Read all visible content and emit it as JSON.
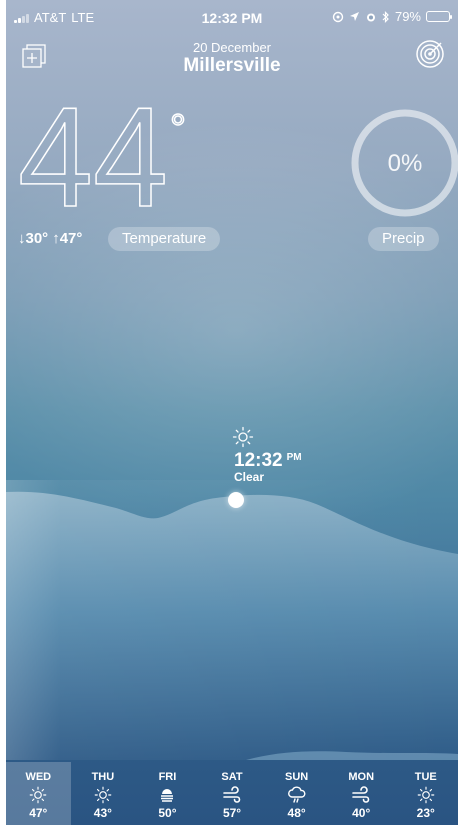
{
  "status_bar": {
    "carrier": "AT&T",
    "network": "LTE",
    "time": "12:32 PM",
    "battery": "79%",
    "battery_level": 0.79,
    "icons": [
      "screen-lock-icon",
      "location-icon",
      "alarm-icon",
      "bluetooth-icon"
    ]
  },
  "header": {
    "date": "20 December",
    "city": "Millersville",
    "left_icon": "add-location-icon",
    "right_icon": "radar-target-icon"
  },
  "current": {
    "temperature": "44",
    "degree": "°",
    "low": "↓30°",
    "high": "↑47°",
    "temperature_label": "Temperature",
    "precip_value": "0%",
    "precip_level": 0.0,
    "precip_label": "Precip"
  },
  "timeline": {
    "time": "12:32",
    "ampm": "PM",
    "condition": "Clear",
    "icon": "sun-icon"
  },
  "forecast": [
    {
      "day": "WED",
      "icon": "sun-icon",
      "temp": "47°",
      "active": true
    },
    {
      "day": "THU",
      "icon": "sun-icon",
      "temp": "43°",
      "active": false
    },
    {
      "day": "FRI",
      "icon": "fog-icon",
      "temp": "50°",
      "active": false
    },
    {
      "day": "SAT",
      "icon": "wind-icon",
      "temp": "57°",
      "active": false
    },
    {
      "day": "SUN",
      "icon": "rain-cloud-icon",
      "temp": "48°",
      "active": false
    },
    {
      "day": "MON",
      "icon": "wind-icon",
      "temp": "40°",
      "active": false
    },
    {
      "day": "TUE",
      "icon": "sun-icon",
      "temp": "23°",
      "active": false
    }
  ]
}
